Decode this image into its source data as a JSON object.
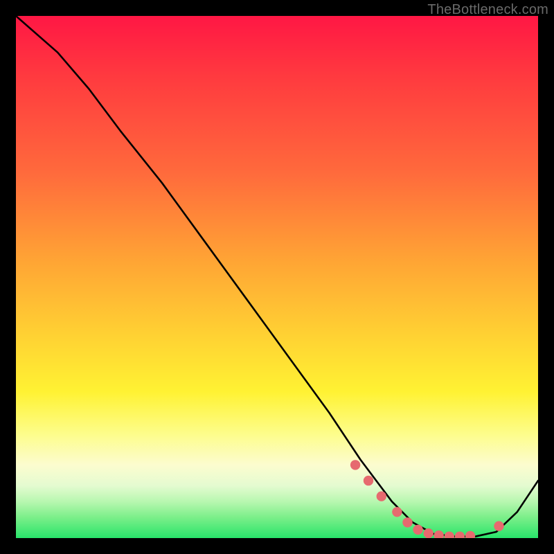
{
  "watermark": "TheBottleneck.com",
  "chart_data": {
    "type": "line",
    "title": "",
    "xlabel": "",
    "ylabel": "",
    "xlim": [
      0,
      100
    ],
    "ylim": [
      0,
      100
    ],
    "series": [
      {
        "name": "bottleneck-curve",
        "x": [
          0,
          8,
          14,
          20,
          28,
          36,
          44,
          52,
          60,
          66,
          72,
          76,
          80,
          84,
          88,
          92,
          96,
          100
        ],
        "y": [
          100,
          93,
          86,
          78,
          68,
          57,
          46,
          35,
          24,
          15,
          7,
          3,
          0.8,
          0.3,
          0.3,
          1.2,
          5,
          11
        ]
      }
    ],
    "markers": {
      "name": "highlight-dots",
      "color": "#e66a6f",
      "x": [
        65,
        67.5,
        70,
        73,
        75,
        77,
        79,
        81,
        83,
        85,
        87,
        92.5
      ],
      "y": [
        14,
        11,
        8,
        5,
        3,
        1.6,
        0.9,
        0.5,
        0.3,
        0.3,
        0.4,
        2.3
      ]
    }
  }
}
